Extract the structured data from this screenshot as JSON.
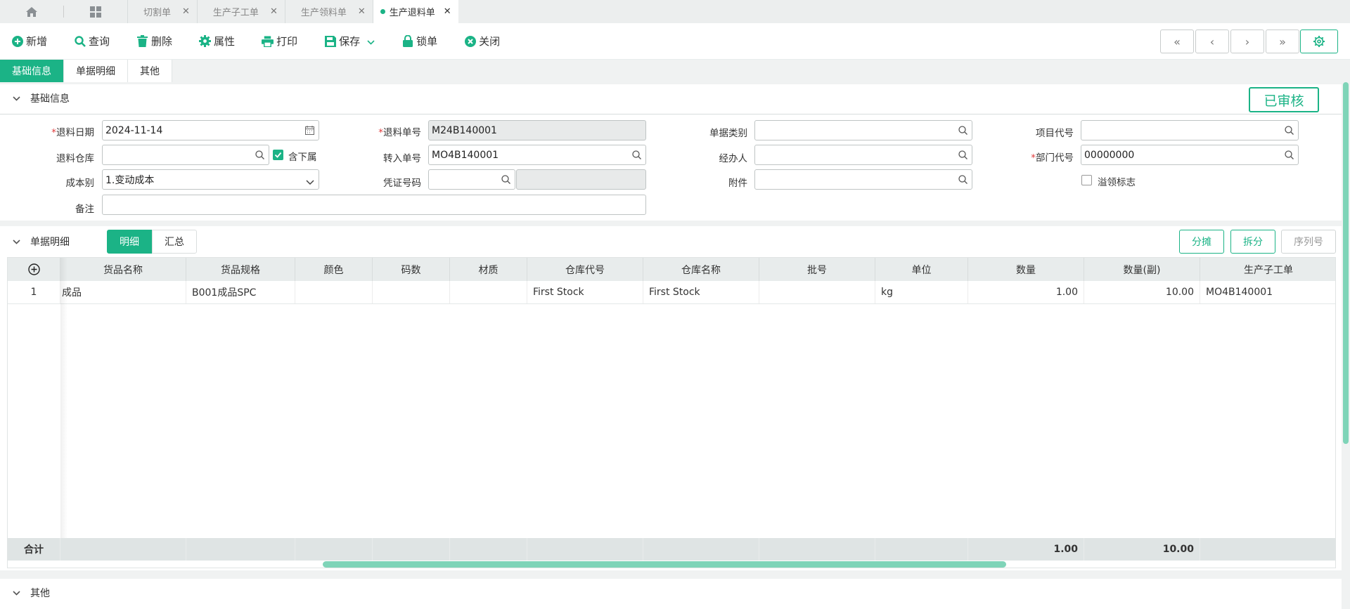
{
  "tabs": [
    {
      "label": "切割单"
    },
    {
      "label": "生产子工单"
    },
    {
      "label": "生产领料单"
    },
    {
      "label": "生产退料单",
      "active": true
    }
  ],
  "toolbar": {
    "new": "新增",
    "query": "查询",
    "delete": "删除",
    "properties": "属性",
    "print": "打印",
    "save": "保存",
    "lock": "锁单",
    "close": "关闭"
  },
  "page_tabs": [
    "基础信息",
    "单据明细",
    "其他"
  ],
  "basic": {
    "section_title": "基础信息",
    "status": "已审核",
    "return_date_label": "退料日期",
    "return_date": "2024-11-14",
    "return_no_label": "退料单号",
    "return_no": "M24B140001",
    "doc_type_label": "单据类别",
    "doc_type": "",
    "project_code_label": "项目代号",
    "project_code": "",
    "warehouse_label": "退料仓库",
    "warehouse": "",
    "include_sub_label": "含下属",
    "transfer_no_label": "转入单号",
    "transfer_no": "MO4B140001",
    "handler_label": "经办人",
    "handler": "",
    "dept_code_label": "部门代号",
    "dept_code": "00000000",
    "cost_label": "成本别",
    "cost": "1.变动成本",
    "voucher_label": "凭证号码",
    "attach_label": "附件",
    "overflow_label": "溢领标志",
    "remark_label": "备注"
  },
  "detail": {
    "section_title": "单据明细",
    "seg_detail": "明细",
    "seg_summary": "汇总",
    "btn_allocate": "分摊",
    "btn_split": "拆分",
    "btn_serial": "序列号",
    "columns": [
      "货品名称",
      "货品规格",
      "颜色",
      "码数",
      "材质",
      "仓库代号",
      "仓库名称",
      "批号",
      "单位",
      "数量",
      "数量(副)",
      "生产子工单"
    ],
    "rows": [
      {
        "idx": "1",
        "name": "成品",
        "spec": "B001成品SPC",
        "color": "",
        "size": "",
        "material": "",
        "wh_code": "First Stock",
        "wh_name": "First Stock",
        "batch": "",
        "unit": "kg",
        "qty": "1.00",
        "qty2": "10.00",
        "sub_order": "MO4B140001"
      }
    ],
    "footer_label": "合计",
    "total_qty": "1.00",
    "total_qty2": "10.00"
  },
  "other": {
    "section_title": "其他"
  },
  "colors": {
    "accent": "#1bb386",
    "required": "#e03c3c"
  }
}
